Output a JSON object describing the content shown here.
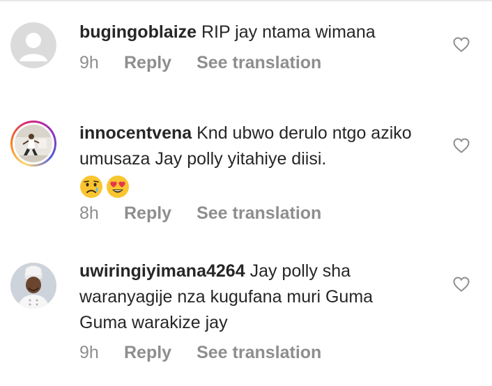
{
  "comments": [
    {
      "username": "bugingoblaize",
      "text": "RIP jay ntama wimana",
      "time": "9h",
      "reply_label": "Reply",
      "translate_label": "See translation",
      "avatar": "default-avatar-icon"
    },
    {
      "username": "innocentvena",
      "text": "Knd ubwo derulo ntgo aziko umusaza Jay polly yitahiye diisi.",
      "emojis": [
        "crying-face-emoji",
        "heart-eyes-emoji"
      ],
      "time": "8h",
      "reply_label": "Reply",
      "translate_label": "See translation",
      "avatar": "user-photo-avatar",
      "has_story_ring": true
    },
    {
      "username": "uwiringiyimana4264",
      "text": "Jay polly sha waranyagije nza kugufana muri Guma Guma warakize jay",
      "time": "9h",
      "reply_label": "Reply",
      "translate_label": "See translation",
      "avatar": "user-photo-avatar"
    }
  ],
  "colors": {
    "text": "#262626",
    "meta": "#8e8e8e",
    "heart_outline": "#8e8e8e"
  }
}
